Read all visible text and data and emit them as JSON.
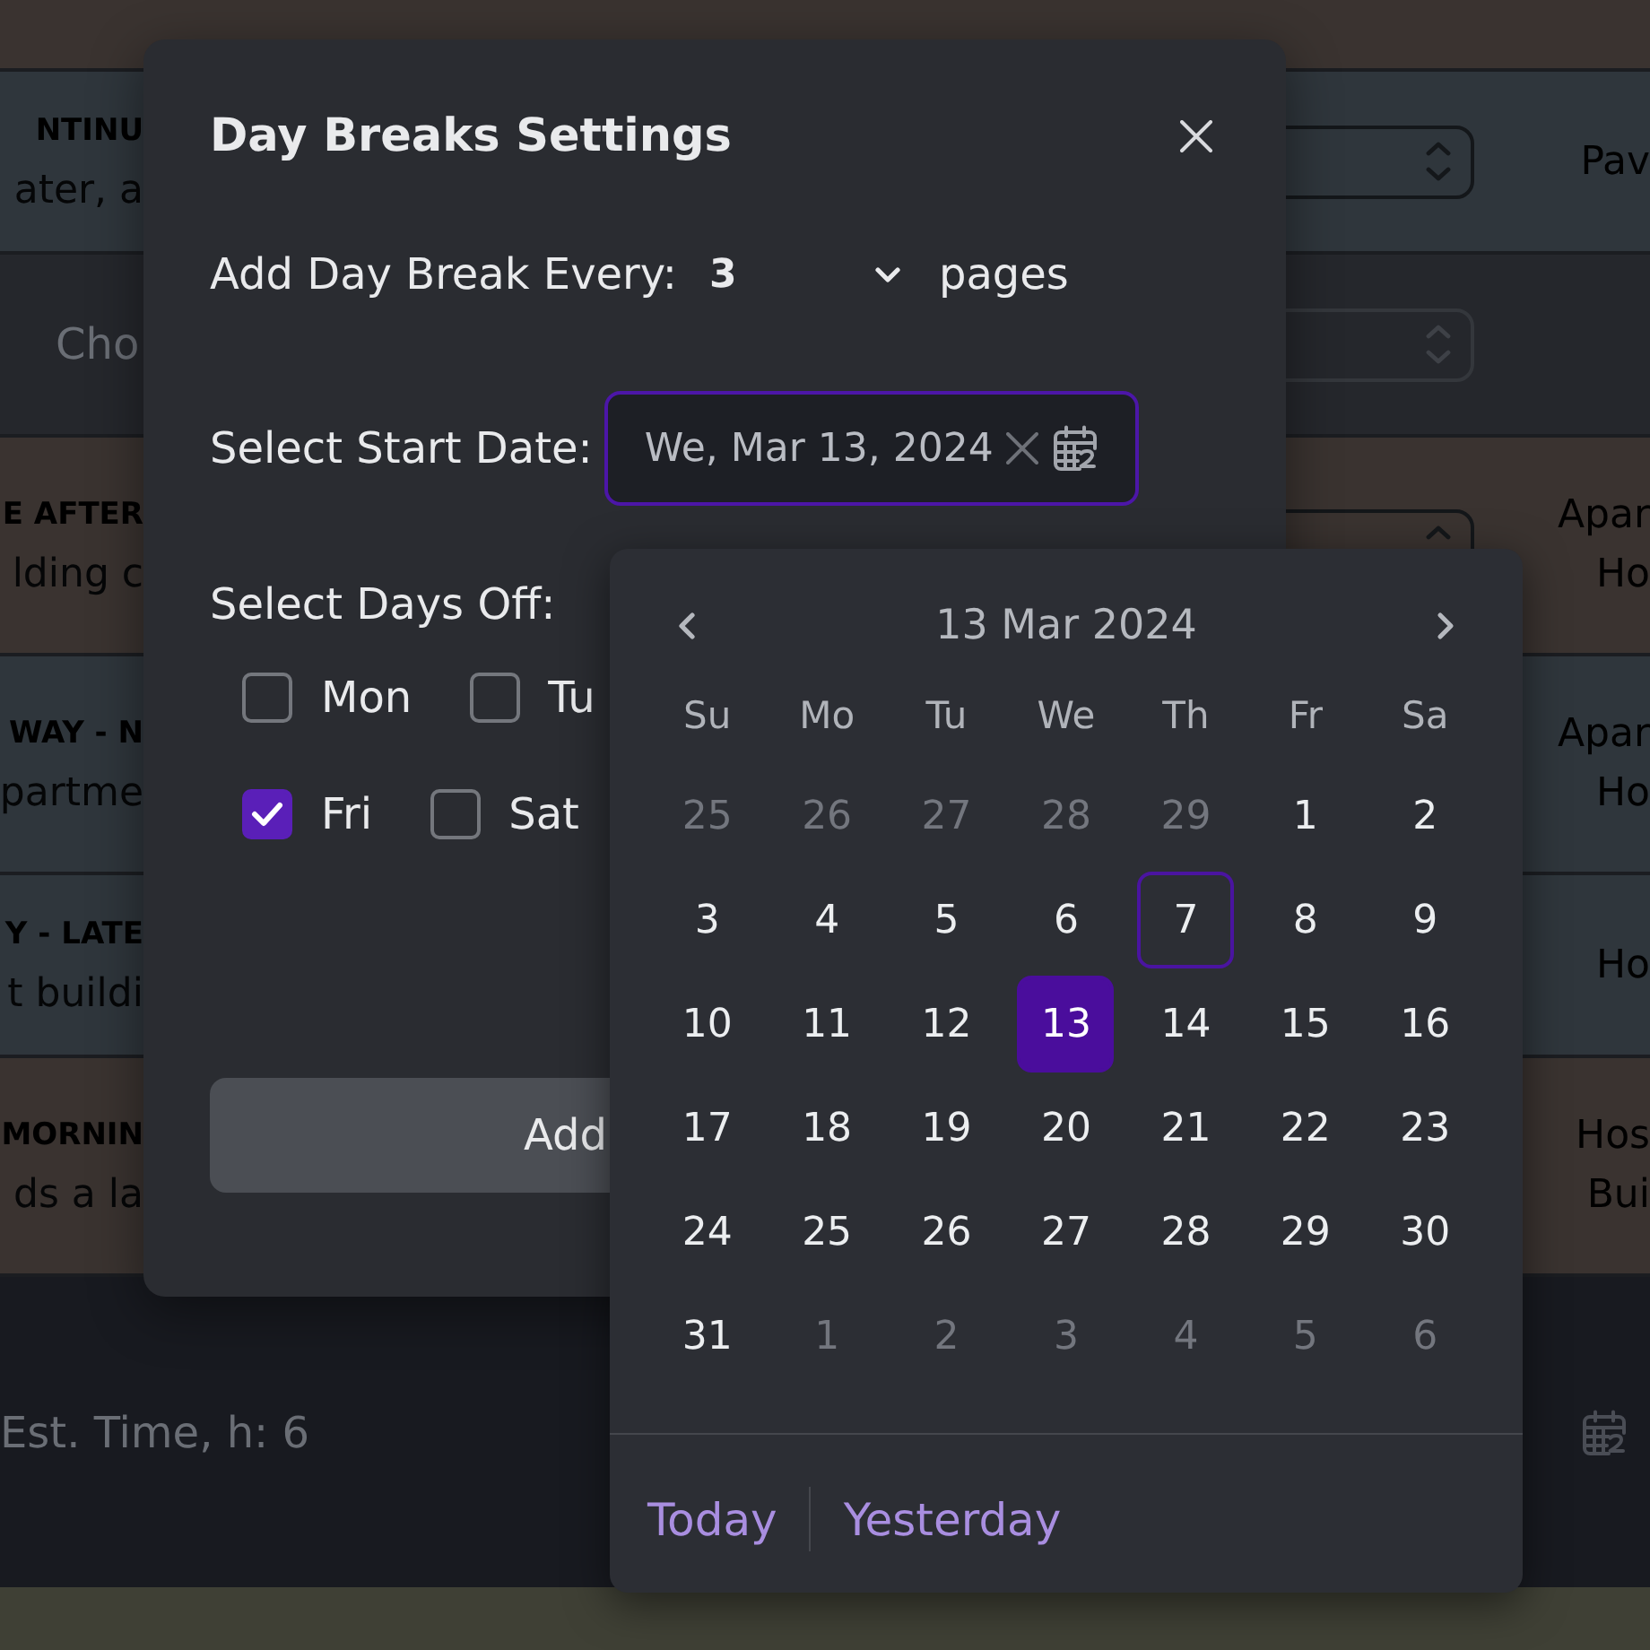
{
  "table": {
    "rows": [
      {
        "kind": "task",
        "color": "#3a3330"
      },
      {
        "kind": "task",
        "color": "#2f363c",
        "title": "NTINU",
        "description": "ater, a",
        "spinner": {
          "disabled": false
        },
        "location": [
          "Pav"
        ]
      },
      {
        "kind": "empty",
        "color": "#25272c",
        "placeholder": "Cho",
        "spinner": {
          "disabled": true
        }
      },
      {
        "kind": "task",
        "color": "#3a3330",
        "title": "E AFTER",
        "description": "lding c",
        "spinner": {
          "disabled": false
        },
        "location": [
          "Apar",
          "Ho"
        ]
      },
      {
        "kind": "task",
        "color": "#2f363c",
        "title": "WAY - N",
        "description": "partme",
        "location": [
          "Apar",
          "Ho"
        ]
      },
      {
        "kind": "task",
        "color": "#2f363c",
        "title": "Y - LATE",
        "description": "t buildi",
        "location": [
          "Ho"
        ]
      },
      {
        "kind": "task",
        "color": "#3a3330",
        "title": "MORNIN",
        "description": "ds a la",
        "location": [
          "Hos",
          "Bui"
        ]
      }
    ]
  },
  "footer": {
    "estimate": "Est. Time, h: 6"
  },
  "dialog": {
    "title": "Day Breaks Settings",
    "interval": {
      "label": "Add Day Break Every:",
      "value": "3",
      "unit": "pages"
    },
    "start_date": {
      "label": "Select Start Date:",
      "value": "We, Mar 13, 2024",
      "focused": true
    },
    "days_off": {
      "label": "Select Days Off:",
      "rows": [
        [
          {
            "label": "Mon",
            "checked": false
          },
          {
            "label": "Tu",
            "checked": false
          }
        ],
        [
          {
            "label": "Fri",
            "checked": true
          },
          {
            "label": "Sat",
            "checked": false
          }
        ]
      ]
    },
    "submit": "Add"
  },
  "calendar": {
    "title": "13 Mar 2024",
    "weekdays": [
      "Su",
      "Mo",
      "Tu",
      "We",
      "Th",
      "Fr",
      "Sa"
    ],
    "weeks": [
      [
        {
          "day": "25",
          "outside_month": true,
          "today": false,
          "selected": false
        },
        {
          "day": "26",
          "outside_month": true,
          "today": false,
          "selected": false
        },
        {
          "day": "27",
          "outside_month": true,
          "today": false,
          "selected": false
        },
        {
          "day": "28",
          "outside_month": true,
          "today": false,
          "selected": false
        },
        {
          "day": "29",
          "outside_month": true,
          "today": false,
          "selected": false
        },
        {
          "day": "1",
          "outside_month": false,
          "today": false,
          "selected": false
        },
        {
          "day": "2",
          "outside_month": false,
          "today": false,
          "selected": false
        }
      ],
      [
        {
          "day": "3",
          "outside_month": false,
          "today": false,
          "selected": false
        },
        {
          "day": "4",
          "outside_month": false,
          "today": false,
          "selected": false
        },
        {
          "day": "5",
          "outside_month": false,
          "today": false,
          "selected": false
        },
        {
          "day": "6",
          "outside_month": false,
          "today": false,
          "selected": false
        },
        {
          "day": "7",
          "outside_month": false,
          "today": true,
          "selected": false
        },
        {
          "day": "8",
          "outside_month": false,
          "today": false,
          "selected": false
        },
        {
          "day": "9",
          "outside_month": false,
          "today": false,
          "selected": false
        }
      ],
      [
        {
          "day": "10",
          "outside_month": false,
          "today": false,
          "selected": false
        },
        {
          "day": "11",
          "outside_month": false,
          "today": false,
          "selected": false
        },
        {
          "day": "12",
          "outside_month": false,
          "today": false,
          "selected": false
        },
        {
          "day": "13",
          "outside_month": false,
          "today": false,
          "selected": true
        },
        {
          "day": "14",
          "outside_month": false,
          "today": false,
          "selected": false
        },
        {
          "day": "15",
          "outside_month": false,
          "today": false,
          "selected": false
        },
        {
          "day": "16",
          "outside_month": false,
          "today": false,
          "selected": false
        }
      ],
      [
        {
          "day": "17",
          "outside_month": false,
          "today": false,
          "selected": false
        },
        {
          "day": "18",
          "outside_month": false,
          "today": false,
          "selected": false
        },
        {
          "day": "19",
          "outside_month": false,
          "today": false,
          "selected": false
        },
        {
          "day": "20",
          "outside_month": false,
          "today": false,
          "selected": false
        },
        {
          "day": "21",
          "outside_month": false,
          "today": false,
          "selected": false
        },
        {
          "day": "22",
          "outside_month": false,
          "today": false,
          "selected": false
        },
        {
          "day": "23",
          "outside_month": false,
          "today": false,
          "selected": false
        }
      ],
      [
        {
          "day": "24",
          "outside_month": false,
          "today": false,
          "selected": false
        },
        {
          "day": "25",
          "outside_month": false,
          "today": false,
          "selected": false
        },
        {
          "day": "26",
          "outside_month": false,
          "today": false,
          "selected": false
        },
        {
          "day": "27",
          "outside_month": false,
          "today": false,
          "selected": false
        },
        {
          "day": "28",
          "outside_month": false,
          "today": false,
          "selected": false
        },
        {
          "day": "29",
          "outside_month": false,
          "today": false,
          "selected": false
        },
        {
          "day": "30",
          "outside_month": false,
          "today": false,
          "selected": false
        }
      ],
      [
        {
          "day": "31",
          "outside_month": false,
          "today": false,
          "selected": false
        },
        {
          "day": "1",
          "outside_month": true,
          "today": false,
          "selected": false
        },
        {
          "day": "2",
          "outside_month": true,
          "today": false,
          "selected": false
        },
        {
          "day": "3",
          "outside_month": true,
          "today": false,
          "selected": false
        },
        {
          "day": "4",
          "outside_month": true,
          "today": false,
          "selected": false
        },
        {
          "day": "5",
          "outside_month": true,
          "today": false,
          "selected": false
        },
        {
          "day": "6",
          "outside_month": true,
          "today": false,
          "selected": false
        }
      ]
    ],
    "shortcuts": [
      "Today",
      "Yesterday"
    ]
  }
}
